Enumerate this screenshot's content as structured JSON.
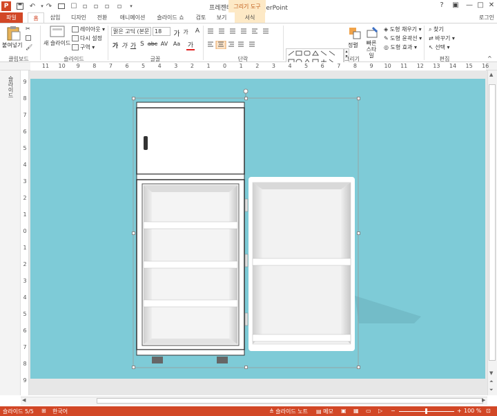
{
  "app": {
    "title": "프레젠테이션1 - PowerPoint",
    "logo": "P",
    "context_tab_group": "그리기 도구",
    "login": "로그인"
  },
  "quick_access": {
    "save_icon": "save-icon",
    "undo_icon": "undo-icon",
    "redo_icon": "redo-icon"
  },
  "window_controls": {
    "help": "?",
    "minimize": "—",
    "restore": "□",
    "close": "✕"
  },
  "tabs": [
    "파일",
    "홈",
    "삽입",
    "디자인",
    "전환",
    "애니메이션",
    "슬라이드 쇼",
    "검토",
    "보기",
    "서식"
  ],
  "ribbon": {
    "clipboard": {
      "paste": "붙여넣기",
      "label": "클립보드"
    },
    "slides": {
      "new_slide": "새 슬라이드",
      "layout": "레이아웃",
      "reset": "다시 설정",
      "section": "구역",
      "label": "슬라이드"
    },
    "font": {
      "font_name": "맑은 고딕 (본문",
      "font_size": "18",
      "bold": "가",
      "italic": "가",
      "underline": "가",
      "shadow": "S",
      "strike": "abc",
      "spacing": "AV",
      "case": "Aa",
      "color": "가",
      "grow": "가",
      "shrink": "가",
      "clear": "A",
      "label": "글꼴"
    },
    "paragraph": {
      "label": "단락"
    },
    "drawing": {
      "arrange": "정렬",
      "quick_styles": "빠른 스타일",
      "fill": "도형 채우기",
      "outline": "도형 윤곽선",
      "effects": "도형 효과",
      "label": "그리기"
    },
    "editing": {
      "find": "찾기",
      "replace": "바꾸기",
      "select": "선택",
      "label": "편집"
    }
  },
  "ruler_h": [
    "11",
    "10",
    "9",
    "8",
    "7",
    "6",
    "5",
    "4",
    "3",
    "2",
    "1",
    "0",
    "1",
    "2",
    "3",
    "4",
    "5",
    "6",
    "7",
    "8",
    "9",
    "10",
    "11",
    "12",
    "13",
    "14",
    "15",
    "16"
  ],
  "ruler_v": [
    "9",
    "8",
    "7",
    "6",
    "5",
    "4",
    "3",
    "2",
    "1",
    "0",
    "1",
    "2",
    "3",
    "4",
    "5",
    "6",
    "7",
    "8",
    "9"
  ],
  "left_pane": {
    "label": "슬라이드"
  },
  "status": {
    "slide_counter": "슬라이드 5/5",
    "language": "한국어",
    "notes": "슬라이드 노트",
    "comments": "메모",
    "zoom": "100 %"
  },
  "colors": {
    "accent": "#d24726",
    "slide_bg": "#7ecbd7",
    "context_tab": "#fde9c6"
  }
}
